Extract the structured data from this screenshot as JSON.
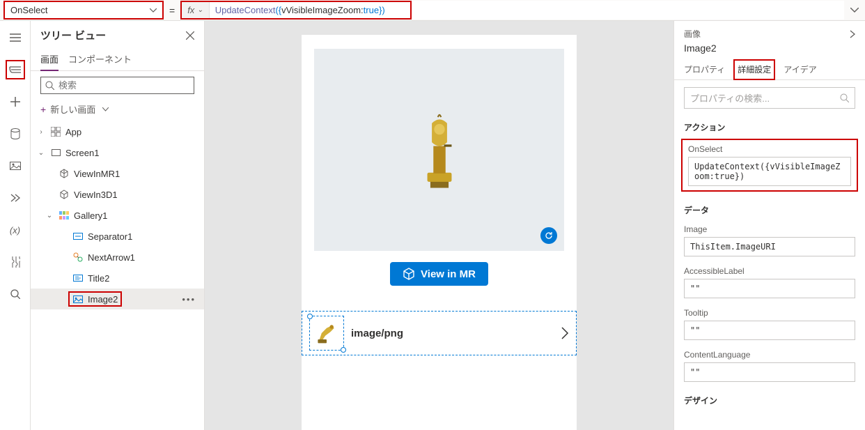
{
  "formulaBar": {
    "propertyName": "OnSelect",
    "equals": "=",
    "fxLabel": "fx",
    "formula": {
      "func": "UpdateContext",
      "open": "({",
      "var": "vVisibleImageZoom:",
      "val": "true",
      "close": "})"
    }
  },
  "leftRail": {
    "items": [
      "menu",
      "layers",
      "add",
      "data",
      "media",
      "advanced",
      "vars",
      "tools",
      "search"
    ]
  },
  "treePanel": {
    "title": "ツリー ビュー",
    "tabs": {
      "screens": "画面",
      "components": "コンポーネント"
    },
    "search_placeholder": "検索",
    "newScreen": "新しい画面",
    "items": {
      "app": "App",
      "screen1": "Screen1",
      "viewInMR": "ViewInMR1",
      "viewIn3D": "ViewIn3D1",
      "gallery1": "Gallery1",
      "separator1": "Separator1",
      "nextArrow1": "NextArrow1",
      "title2": "Title2",
      "image2": "Image2"
    }
  },
  "canvas": {
    "viewInMR": "View in MR",
    "rowLabel": "image/png"
  },
  "propsPanel": {
    "type": "画像",
    "name": "Image2",
    "tabs": {
      "props": "プロパティ",
      "advanced": "詳細設定",
      "ideas": "アイデア"
    },
    "search_placeholder": "プロパティの検索...",
    "sections": {
      "action": "アクション",
      "data": "データ",
      "design": "デザイン"
    },
    "onSelect": {
      "label": "OnSelect",
      "value": "UpdateContext({vVisibleImageZoom:true})"
    },
    "fields": {
      "image": {
        "label": "Image",
        "value": "ThisItem.ImageURI"
      },
      "accessibleLabel": {
        "label": "AccessibleLabel",
        "value": "\"\""
      },
      "tooltip": {
        "label": "Tooltip",
        "value": "\"\""
      },
      "contentLanguage": {
        "label": "ContentLanguage",
        "value": "\"\""
      }
    }
  }
}
